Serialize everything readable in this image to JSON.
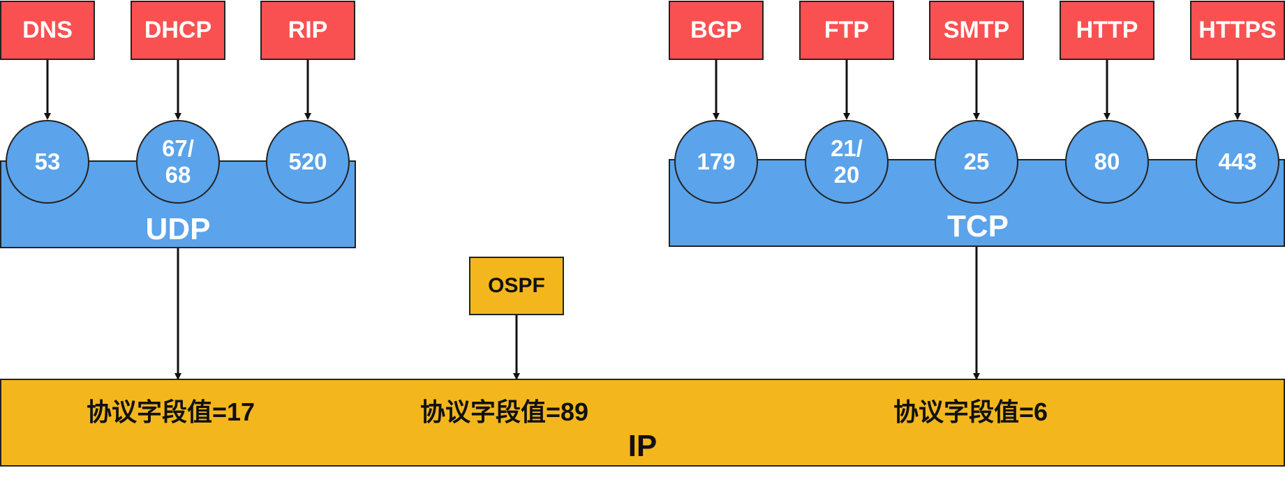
{
  "udp": {
    "label": "UDP",
    "apps": [
      {
        "name": "DNS",
        "port": "53"
      },
      {
        "name": "DHCP",
        "port": "67/\n68"
      },
      {
        "name": "RIP",
        "port": "520"
      }
    ]
  },
  "tcp": {
    "label": "TCP",
    "apps": [
      {
        "name": "BGP",
        "port": "179"
      },
      {
        "name": "FTP",
        "port": "21/\n20"
      },
      {
        "name": "SMTP",
        "port": "25"
      },
      {
        "name": "HTTP",
        "port": "80"
      },
      {
        "name": "HTTPS",
        "port": "443"
      }
    ]
  },
  "ospf": {
    "label": "OSPF"
  },
  "ip": {
    "label": "IP",
    "fields": [
      "协议字段值=17",
      "协议字段值=89",
      "协议字段值=6"
    ]
  },
  "colors": {
    "app_box": "#f95151",
    "transport": "#5ba3ea",
    "network": "#f3b71d"
  }
}
